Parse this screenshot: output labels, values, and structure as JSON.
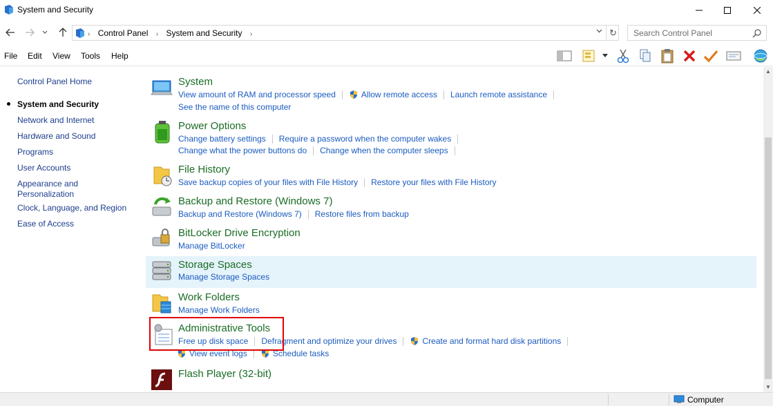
{
  "window": {
    "title": "System and Security",
    "minimize_glyph": "—",
    "maximize_glyph": "☐",
    "close_glyph": "✕"
  },
  "nav": {
    "back_glyph": "←",
    "forward_glyph": "→",
    "recent_glyph": "⌄",
    "up_glyph": "↑",
    "breadcrumb_root_glyph": "›",
    "crumbs": [
      "Control Panel",
      "System and Security"
    ],
    "crumb_sep": "›",
    "dropdown_glyph": "⌄",
    "refresh_glyph": "↻",
    "search_placeholder": "Search Control Panel"
  },
  "menu": [
    "File",
    "Edit",
    "View",
    "Tools",
    "Help"
  ],
  "toolbar_icons": [
    "layout-icon",
    "folder-options-icon",
    "dropdown-icon",
    "cut-icon",
    "copy-icon",
    "paste-icon",
    "delete-icon",
    "check-icon",
    "properties-icon",
    "globe-icon"
  ],
  "left_nav": {
    "items": [
      {
        "label": "Control Panel Home",
        "current": false
      },
      {
        "label": "System and Security",
        "current": true
      },
      {
        "label": "Network and Internet",
        "current": false
      },
      {
        "label": "Hardware and Sound",
        "current": false
      },
      {
        "label": "Programs",
        "current": false
      },
      {
        "label": "User Accounts",
        "current": false
      },
      {
        "label": "Appearance and",
        "label2": "Personalization",
        "current": false
      },
      {
        "label": "Clock, Language, and Region",
        "current": false
      },
      {
        "label": "Ease of Access",
        "current": false
      }
    ]
  },
  "categories": [
    {
      "icon": "system-icon",
      "title": "System",
      "rows": [
        [
          {
            "text": "View amount of RAM and processor speed"
          },
          {
            "text": "Allow remote access",
            "shield": true
          },
          {
            "text": "Launch remote assistance"
          }
        ],
        [
          {
            "text": "See the name of this computer"
          }
        ]
      ]
    },
    {
      "icon": "power-options-icon",
      "title": "Power Options",
      "rows": [
        [
          {
            "text": "Change battery settings"
          },
          {
            "text": "Require a password when the computer wakes"
          }
        ],
        [
          {
            "text": "Change what the power buttons do"
          },
          {
            "text": "Change when the computer sleeps"
          }
        ]
      ]
    },
    {
      "icon": "file-history-icon",
      "title": "File History",
      "rows": [
        [
          {
            "text": "Save backup copies of your files with File History"
          },
          {
            "text": "Restore your files with File History"
          }
        ]
      ]
    },
    {
      "icon": "backup-restore-icon",
      "title": "Backup and Restore (Windows 7)",
      "rows": [
        [
          {
            "text": "Backup and Restore (Windows 7)"
          },
          {
            "text": "Restore files from backup"
          }
        ]
      ]
    },
    {
      "icon": "bitlocker-icon",
      "title": "BitLocker Drive Encryption",
      "rows": [
        [
          {
            "text": "Manage BitLocker"
          }
        ]
      ]
    },
    {
      "icon": "storage-spaces-icon",
      "title": "Storage Spaces",
      "highlighted": true,
      "rows": [
        [
          {
            "text": "Manage Storage Spaces"
          }
        ]
      ]
    },
    {
      "icon": "work-folders-icon",
      "title": "Work Folders",
      "rows": [
        [
          {
            "text": "Manage Work Folders"
          }
        ]
      ]
    },
    {
      "icon": "administrative-tools-icon",
      "title": "Administrative Tools",
      "rows": [
        [
          {
            "text": "Free up disk space"
          },
          {
            "text": "Defragment and optimize your drives"
          },
          {
            "text": "Create and format hard disk partitions",
            "shield": true
          }
        ],
        [
          {
            "text": "View event logs",
            "shield": true
          },
          {
            "text": "Schedule tasks",
            "shield": true
          }
        ]
      ]
    },
    {
      "icon": "flash-player-icon",
      "title": "Flash Player (32-bit)",
      "rows": []
    }
  ],
  "status": {
    "location": "Computer"
  },
  "scrollbar": {
    "up_glyph": "▲",
    "down_glyph": "▼"
  },
  "colors": {
    "category_title": "#1a6c25",
    "link": "#1a5bbf",
    "highlight_row": "#e5f3fb",
    "annotation_box": "#e00000"
  }
}
